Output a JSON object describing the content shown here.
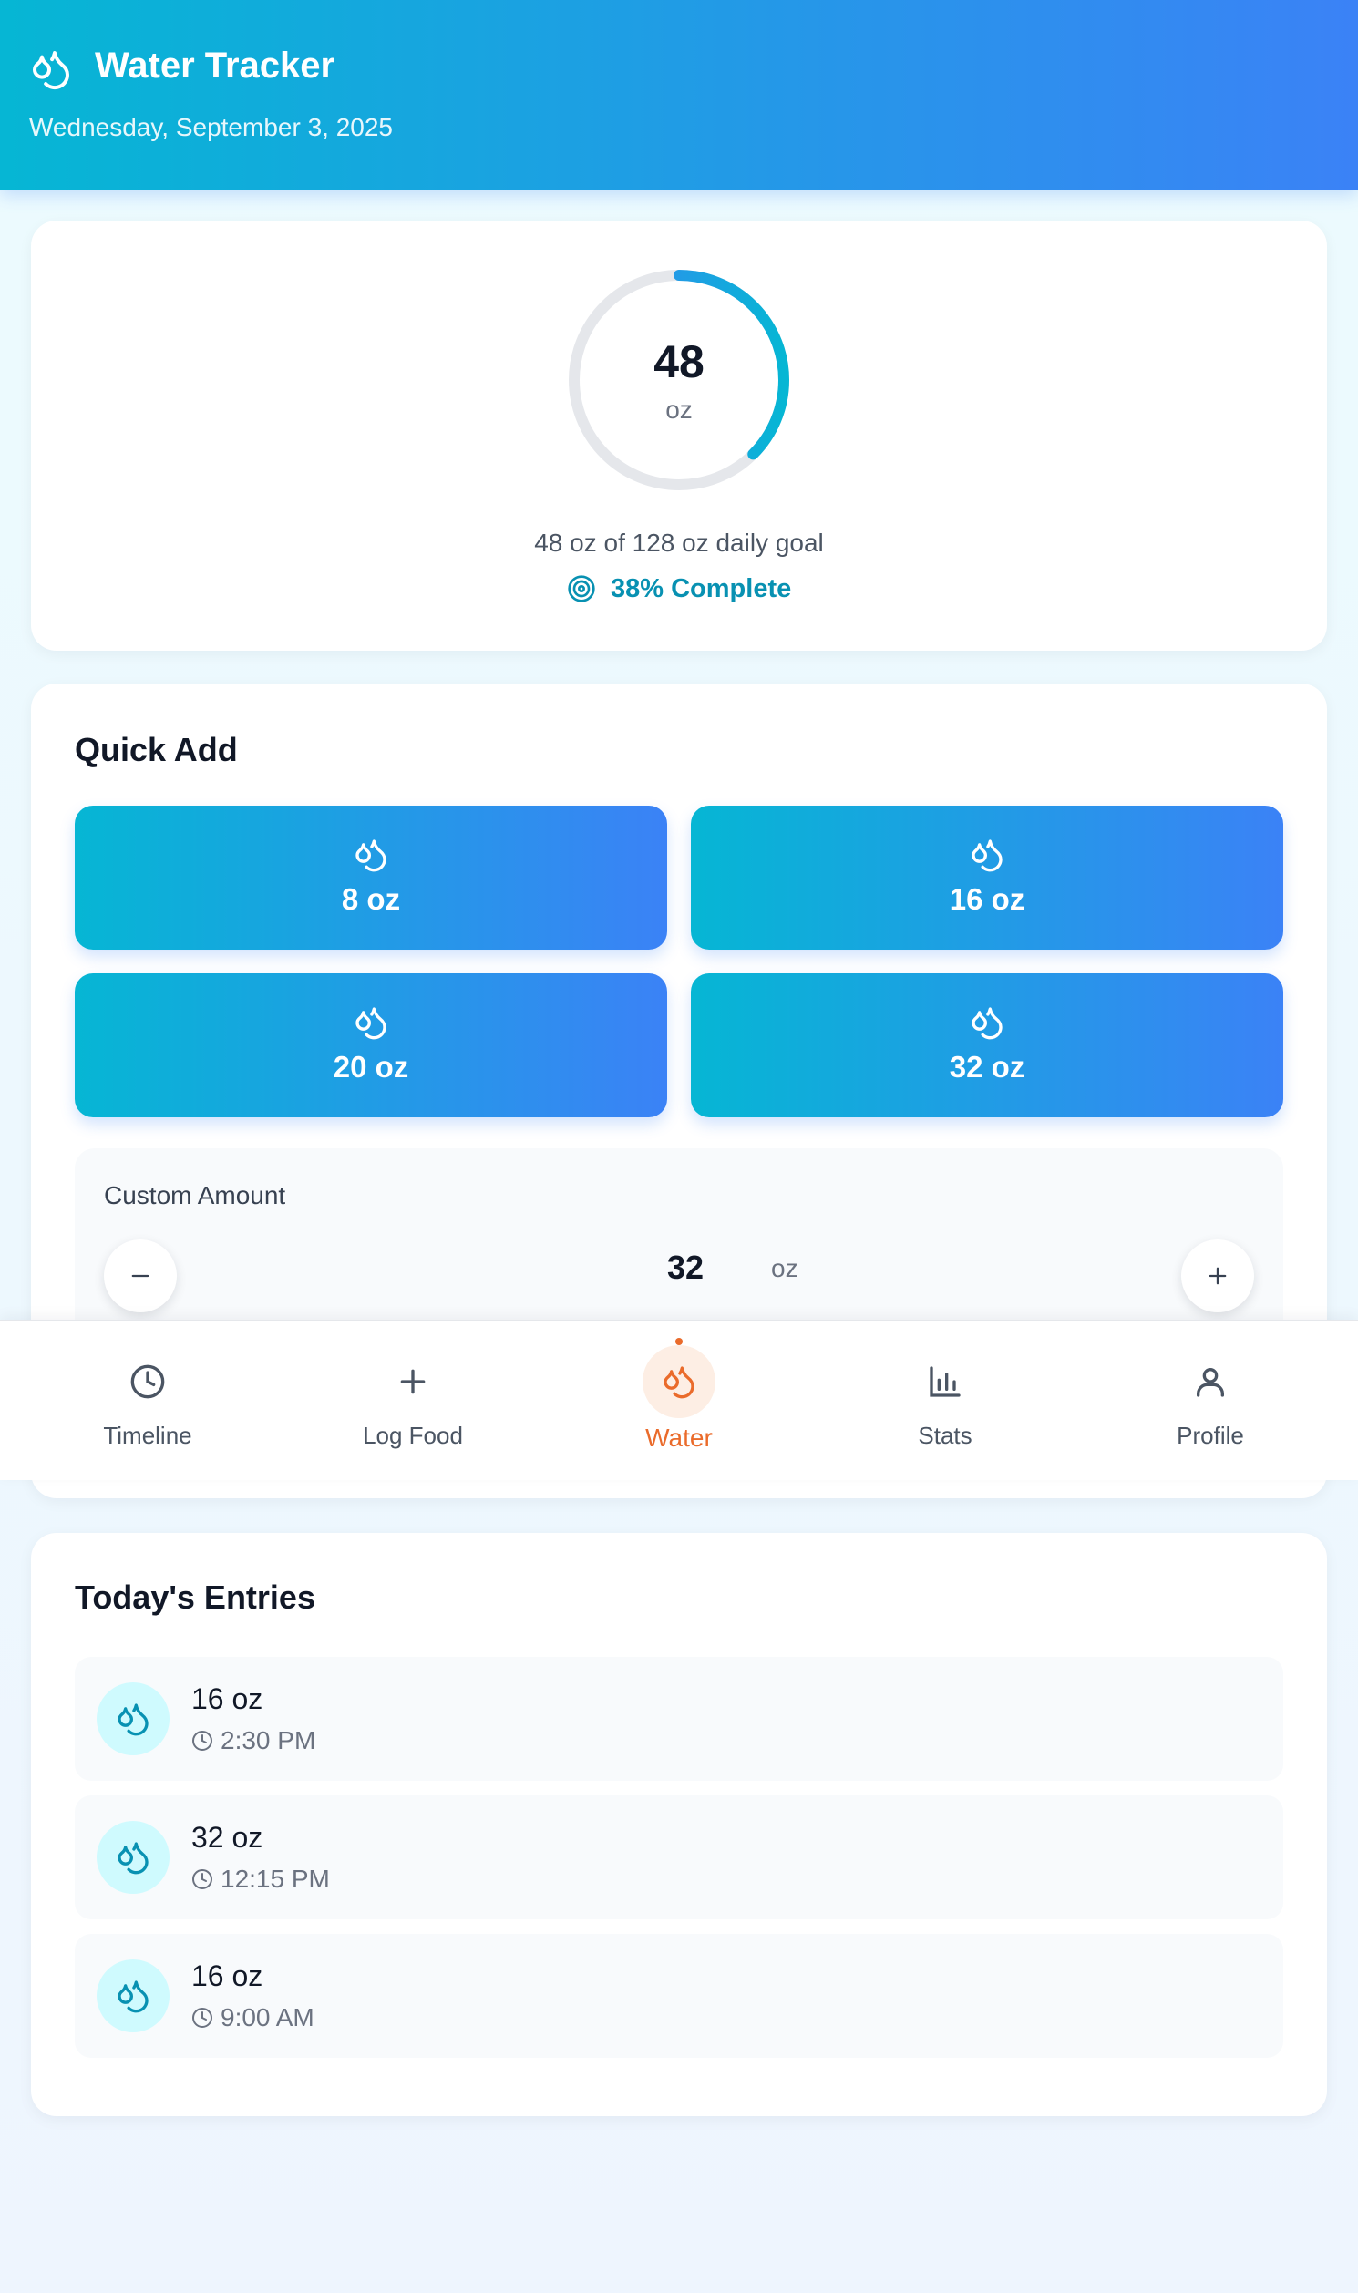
{
  "header": {
    "title": "Water Tracker",
    "date": "Wednesday, September 3, 2025",
    "icon": "droplets-icon"
  },
  "progress": {
    "current": "48",
    "unit": "oz",
    "goal_text": "48 oz of 128 oz daily goal",
    "complete_text": "38% Complete",
    "fraction": 0.375,
    "ring_track_color": "#e5e7eb",
    "ring_gradient": [
      "#3b82f6",
      "#06b6d4"
    ]
  },
  "quick_add": {
    "title": "Quick Add",
    "buttons": [
      {
        "label": "8 oz"
      },
      {
        "label": "16 oz"
      },
      {
        "label": "20 oz"
      },
      {
        "label": "32 oz"
      }
    ],
    "custom": {
      "label": "Custom Amount",
      "value": "32",
      "unit": "oz"
    }
  },
  "nav": {
    "items": [
      {
        "label": "Timeline",
        "icon": "clock-icon"
      },
      {
        "label": "Log Food",
        "icon": "plus-icon"
      },
      {
        "label": "Water",
        "icon": "droplets-icon",
        "active": true
      },
      {
        "label": "Stats",
        "icon": "bar-chart-icon"
      },
      {
        "label": "Profile",
        "icon": "user-icon"
      }
    ],
    "active_color": "#ea6b2b"
  },
  "entries": {
    "title": "Today's Entries",
    "items": [
      {
        "amount": "16 oz",
        "time": "2:30 PM"
      },
      {
        "amount": "32 oz",
        "time": "12:15 PM"
      },
      {
        "amount": "16 oz",
        "time": "9:00 AM"
      }
    ]
  },
  "colors": {
    "accent_start": "#06b6d4",
    "accent_end": "#3b82f6",
    "text_teal": "#0891b2"
  }
}
